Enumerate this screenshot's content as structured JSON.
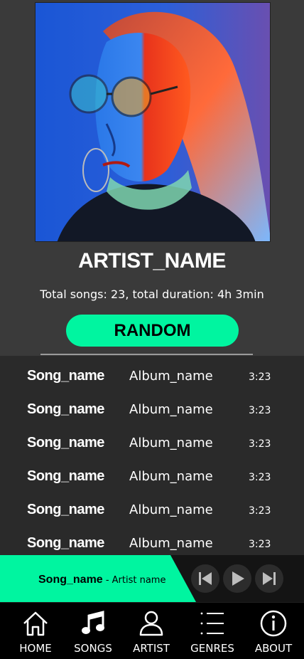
{
  "artist": {
    "name": "ARTIST_NAME",
    "stats": "Total songs: 23, total duration: 4h 3min",
    "random_label": "RANDOM"
  },
  "songs": [
    {
      "title": "Song_name",
      "album": "Album_name",
      "duration": "3:23"
    },
    {
      "title": "Song_name",
      "album": "Album_name",
      "duration": "3:23"
    },
    {
      "title": "Song_name",
      "album": "Album_name",
      "duration": "3:23"
    },
    {
      "title": "Song_name",
      "album": "Album_name",
      "duration": "3:23"
    },
    {
      "title": "Song_name",
      "album": "Album_name",
      "duration": "3:23"
    },
    {
      "title": "Song_name",
      "album": "Album_name",
      "duration": "3:23"
    }
  ],
  "player": {
    "title": "Song_name",
    "separator": " - ",
    "artist": "Artist name"
  },
  "nav": [
    {
      "label": "HOME",
      "icon": "home-icon"
    },
    {
      "label": "SONGS",
      "icon": "music-note-icon"
    },
    {
      "label": "ARTIST",
      "icon": "user-icon"
    },
    {
      "label": "GENRES",
      "icon": "list-icon"
    },
    {
      "label": "ABOUT",
      "icon": "info-icon"
    }
  ],
  "colors": {
    "accent": "#00f5a0",
    "background": "#3a3a3a",
    "list_background": "#2a2a2a",
    "player_background": "#141414",
    "nav_background": "#000000"
  }
}
